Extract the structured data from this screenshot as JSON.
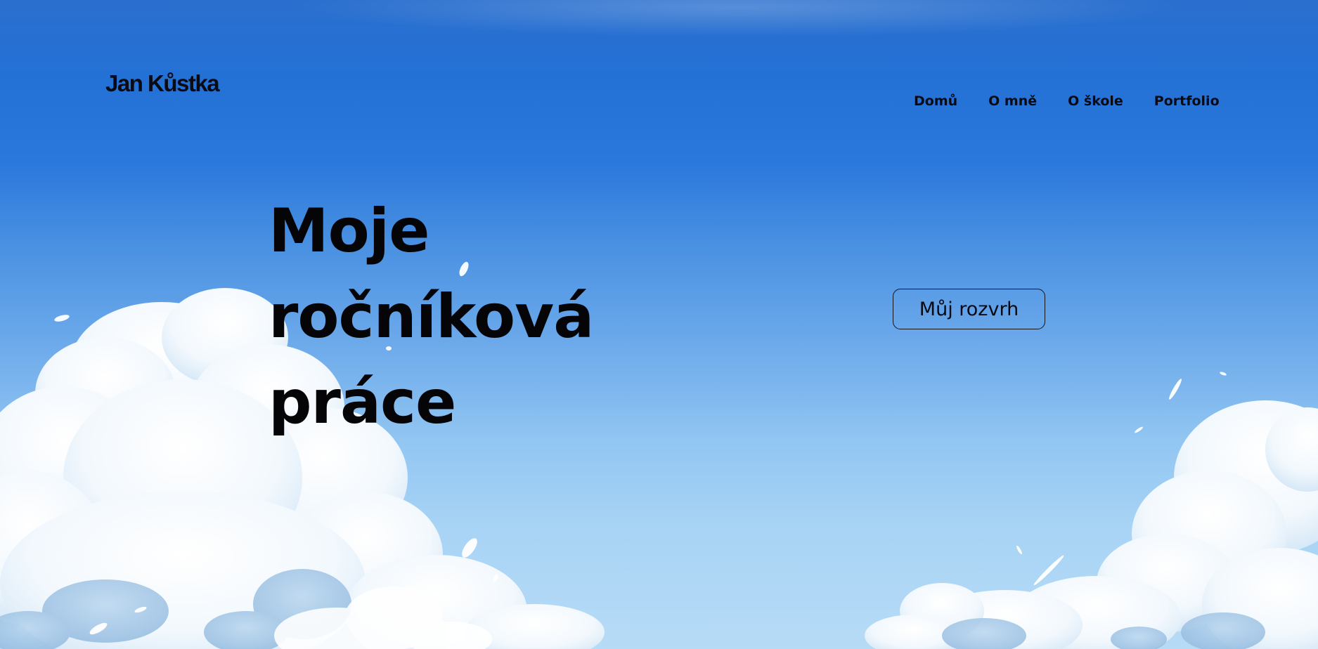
{
  "header": {
    "logo_text": "Jan Kůstka",
    "nav": [
      {
        "label": "Domů"
      },
      {
        "label": "O mně"
      },
      {
        "label": "O škole"
      },
      {
        "label": "Portfolio"
      }
    ]
  },
  "hero": {
    "title_lines": [
      "Moje",
      "ročníková",
      "práce"
    ],
    "cta_label": "Můj rozvrh"
  },
  "background": {
    "description_icon": "sky-clouds-illustration",
    "sky_top_color": "#2471d6",
    "sky_bottom_color": "#b6dbf6",
    "cloud_color": "#ffffff"
  }
}
